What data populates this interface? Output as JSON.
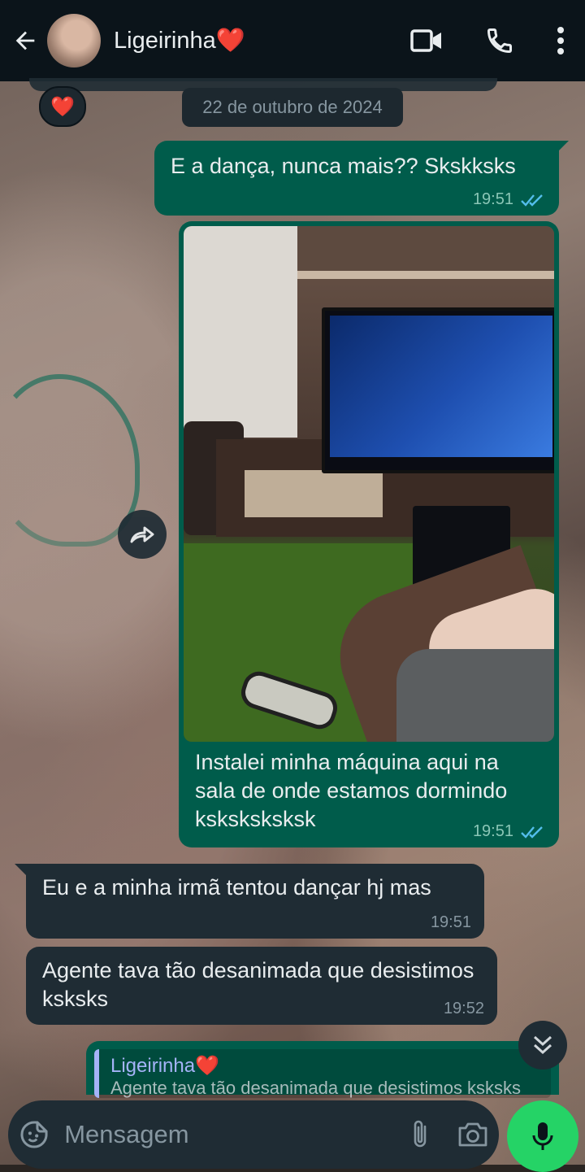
{
  "header": {
    "back_icon": "arrow-left-icon",
    "contact_name": "Ligeirinha❤️",
    "video_call_icon": "video-camera-icon",
    "voice_call_icon": "phone-icon",
    "menu_icon": "more-vertical-icon"
  },
  "reaction": {
    "emoji": "❤️"
  },
  "date_chip": "22 de outubro de 2024",
  "messages": [
    {
      "direction": "outgoing",
      "text": "E a dança, nunca mais?? Skskksks",
      "time": "19:51",
      "status": "read"
    },
    {
      "direction": "outgoing",
      "type": "image",
      "caption": "Instalei minha máquina aqui na sala de onde estamos dormindo ksksksksksk",
      "time": "19:51",
      "status": "read"
    },
    {
      "direction": "incoming",
      "text": "Eu e a minha irmã tentou dançar hj mas",
      "time": "19:51"
    },
    {
      "direction": "incoming",
      "text": "Agente tava tão desanimada que desistimos ksksks",
      "time": "19:52"
    },
    {
      "direction": "outgoing",
      "type": "reply",
      "quote_author": "Ligeirinha❤️",
      "quote_text": "Agente tava tão desanimada que desistimos ksksks"
    }
  ],
  "input": {
    "placeholder": "Mensagem",
    "value": ""
  },
  "colors": {
    "header_bg": "#0b141a",
    "outgoing_bubble": "#005c4b",
    "incoming_bubble": "#1f2c34",
    "read_tick": "#53bdeb",
    "mic_button": "#25d366",
    "quote_accent": "#a5b3f8"
  },
  "icons": {
    "forward": "forward-icon",
    "scroll_down": "double-chevron-down-icon",
    "emoji": "sticker-icon",
    "attach": "paperclip-icon",
    "camera": "camera-icon",
    "mic": "microphone-icon"
  }
}
